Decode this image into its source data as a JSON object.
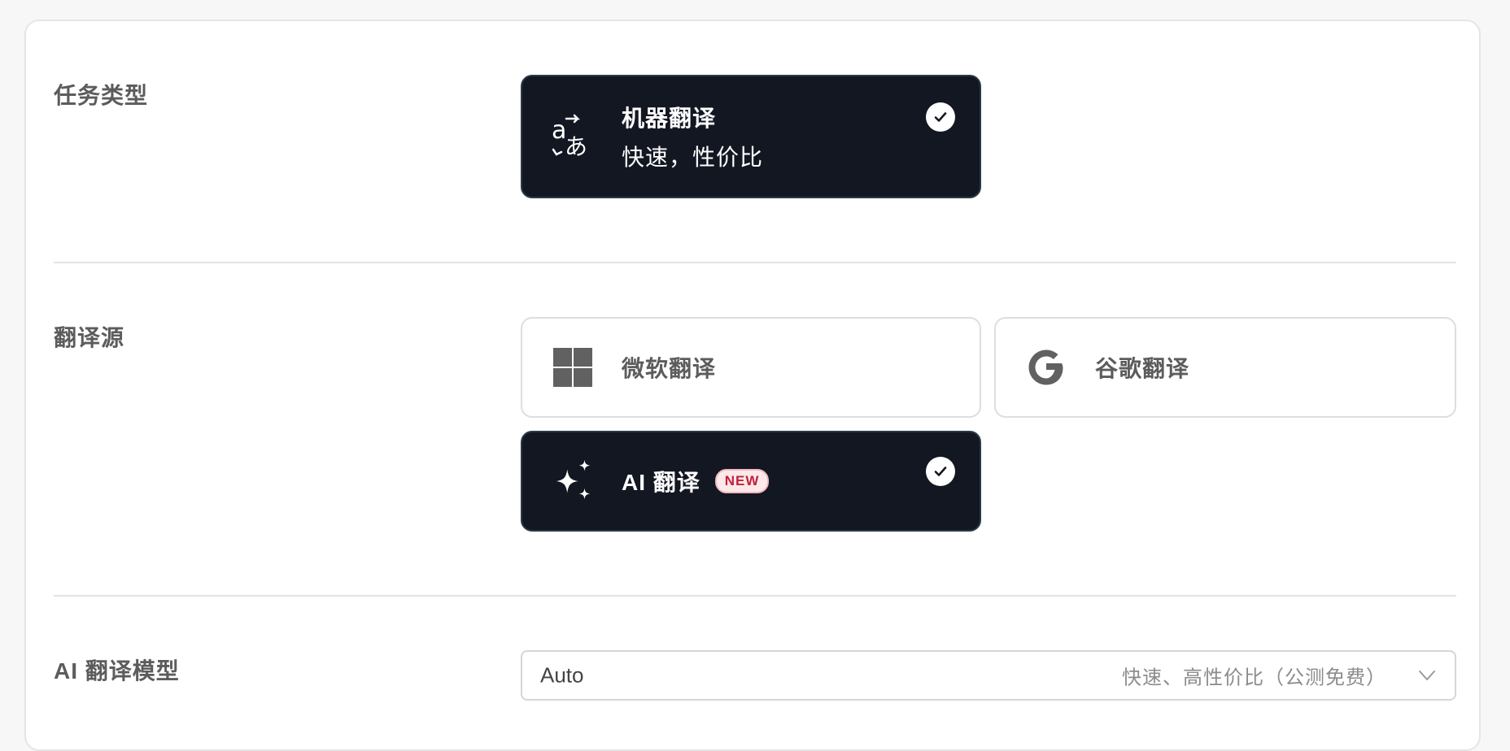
{
  "task_type": {
    "label": "任务类型",
    "option": {
      "title": "机器翻译",
      "subtitle": "快速，性价比",
      "icon": "translate-icon",
      "selected": true
    }
  },
  "source": {
    "label": "翻译源",
    "options": [
      {
        "title": "微软翻译",
        "icon": "microsoft-icon",
        "selected": false
      },
      {
        "title": "谷歌翻译",
        "icon": "google-icon",
        "selected": false
      },
      {
        "title": "AI 翻译",
        "badge": "NEW",
        "icon": "sparkle-icon",
        "selected": true
      }
    ]
  },
  "ai_model": {
    "label": "AI 翻译模型",
    "value": "Auto",
    "hint": "快速、高性价比（公测免费）"
  },
  "colors": {
    "selected_bg": "#131722",
    "badge_text": "#c0213a",
    "badge_bg": "#fde8ea"
  }
}
